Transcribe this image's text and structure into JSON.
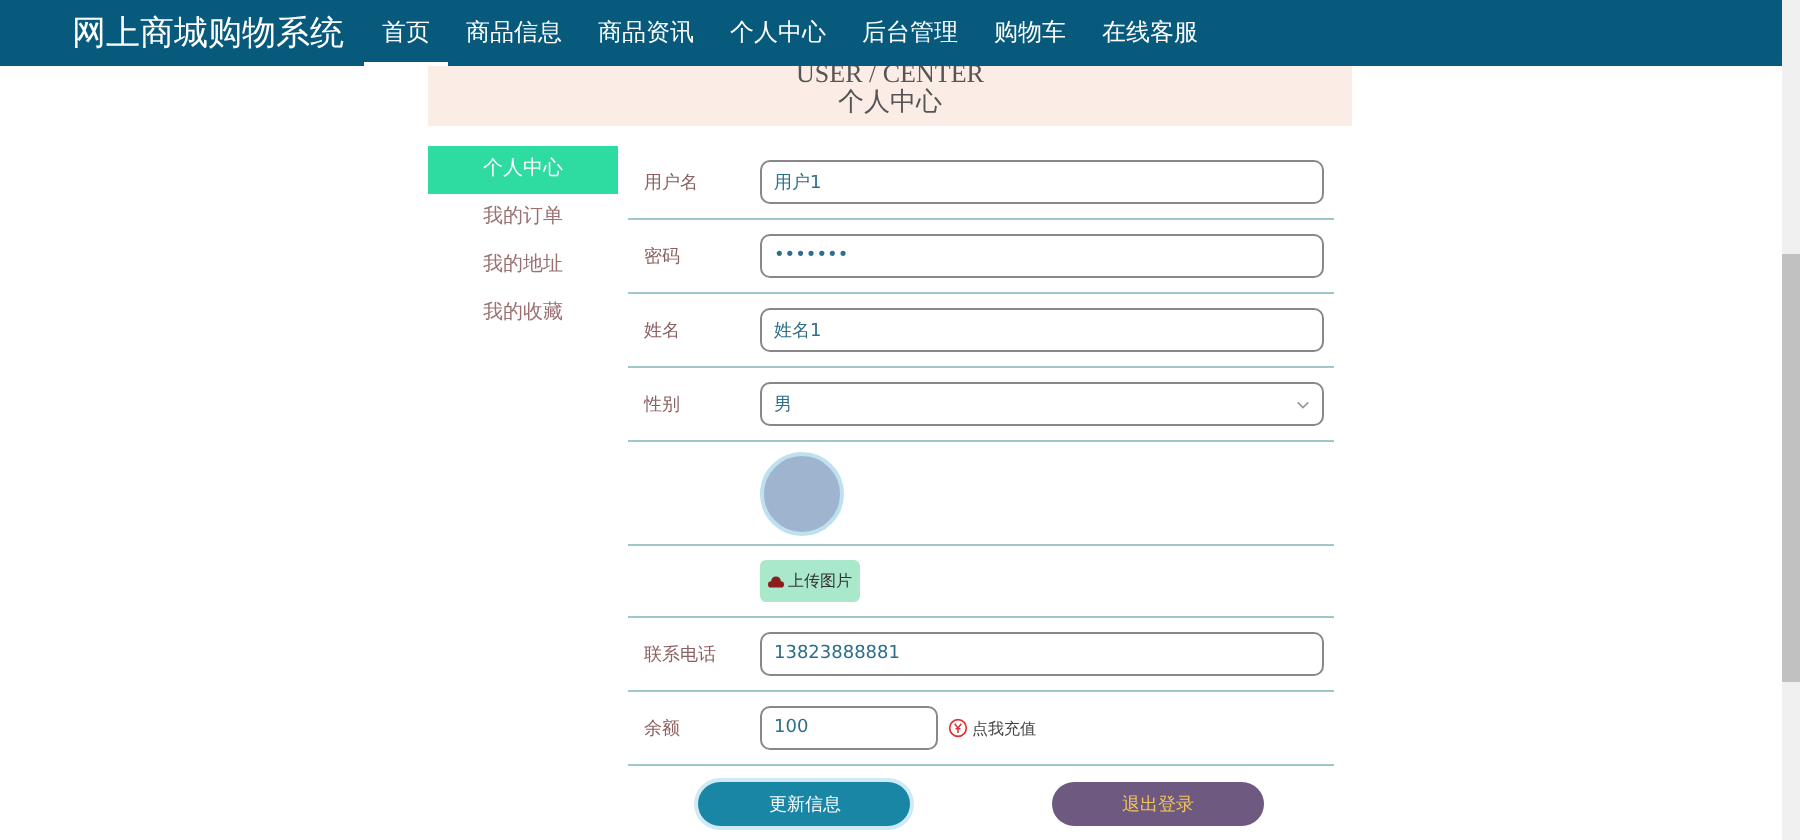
{
  "site_title": "网上商城购物系统",
  "nav": [
    {
      "label": "首页",
      "selected": true
    },
    {
      "label": "商品信息",
      "selected": false
    },
    {
      "label": "商品资讯",
      "selected": false
    },
    {
      "label": "个人中心",
      "selected": false
    },
    {
      "label": "后台管理",
      "selected": false
    },
    {
      "label": "购物车",
      "selected": false
    },
    {
      "label": "在线客服",
      "selected": false
    }
  ],
  "banner": {
    "subtitle": "USER / CENTER",
    "title": "个人中心"
  },
  "sidebar": {
    "items": [
      {
        "label": "个人中心",
        "selected": true
      },
      {
        "label": "我的订单",
        "selected": false
      },
      {
        "label": "我的地址",
        "selected": false
      },
      {
        "label": "我的收藏",
        "selected": false
      }
    ]
  },
  "form": {
    "rows": [
      {
        "kind": "text",
        "label": "用户名",
        "value": "用户1"
      },
      {
        "kind": "text",
        "label": "密码",
        "value": "•••••••"
      },
      {
        "kind": "text",
        "label": "姓名",
        "value": "姓名1"
      },
      {
        "kind": "select",
        "label": "性别",
        "value": "男"
      },
      {
        "kind": "avatar"
      },
      {
        "kind": "upload",
        "button": "上传图片"
      },
      {
        "kind": "text",
        "label": "联系电话",
        "value": "13823888881"
      },
      {
        "kind": "balance",
        "label": "余额",
        "value": "100",
        "link": "点我充值"
      }
    ],
    "buttons": [
      {
        "label": "更新信息",
        "kind": "primary"
      },
      {
        "label": "退出登录",
        "kind": "secondary"
      }
    ]
  }
}
